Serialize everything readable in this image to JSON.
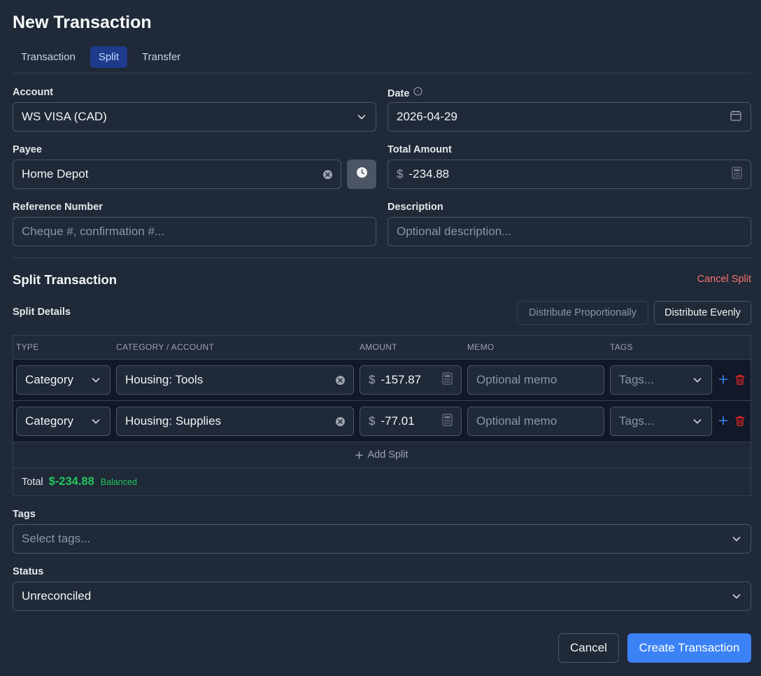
{
  "header": {
    "title": "New Transaction"
  },
  "tabs": [
    {
      "label": "Transaction"
    },
    {
      "label": "Split"
    },
    {
      "label": "Transfer"
    }
  ],
  "form": {
    "account_label": "Account",
    "account_value": "WS VISA (CAD)",
    "date_label": "Date",
    "date_value": "2026-04-29",
    "payee_label": "Payee",
    "payee_value": "Home Depot",
    "total_amount_label": "Total Amount",
    "currency_symbol": "$",
    "total_amount_value": "-234.88",
    "reference_label": "Reference Number",
    "reference_placeholder": "Cheque #, confirmation #...",
    "description_label": "Description",
    "description_placeholder": "Optional description..."
  },
  "split": {
    "title": "Split Transaction",
    "cancel_label": "Cancel Split",
    "details_label": "Split Details",
    "distribute_proportionally": "Distribute Proportionally",
    "distribute_evenly": "Distribute Evenly",
    "columns": [
      "Type",
      "Category / Account",
      "Amount",
      "Memo",
      "Tags"
    ],
    "rows": [
      {
        "type": "Category",
        "category": "Housing: Tools",
        "amount": "-157.87",
        "memo_placeholder": "Optional memo",
        "tags_placeholder": "Tags..."
      },
      {
        "type": "Category",
        "category": "Housing: Supplies",
        "amount": "-77.01",
        "memo_placeholder": "Optional memo",
        "tags_placeholder": "Tags..."
      }
    ],
    "add_split_label": "Add Split",
    "total_label": "Total",
    "total_value": "$-234.88",
    "balance_status": "Balanced"
  },
  "tags": {
    "label": "Tags",
    "placeholder": "Select tags..."
  },
  "status": {
    "label": "Status",
    "value": "Unreconciled"
  },
  "footer": {
    "cancel_label": "Cancel",
    "create_label": "Create Transaction"
  },
  "colors": {
    "background": "#1f2937",
    "accent": "#3b82f6",
    "tab_active": "#1e3a8a",
    "danger": "#f87171",
    "success": "#22c55e"
  },
  "icons": [
    "chevron-down-icon",
    "info-icon",
    "calendar-icon",
    "clear-icon",
    "clock-icon",
    "calculator-icon",
    "plus-icon",
    "trash-icon"
  ]
}
